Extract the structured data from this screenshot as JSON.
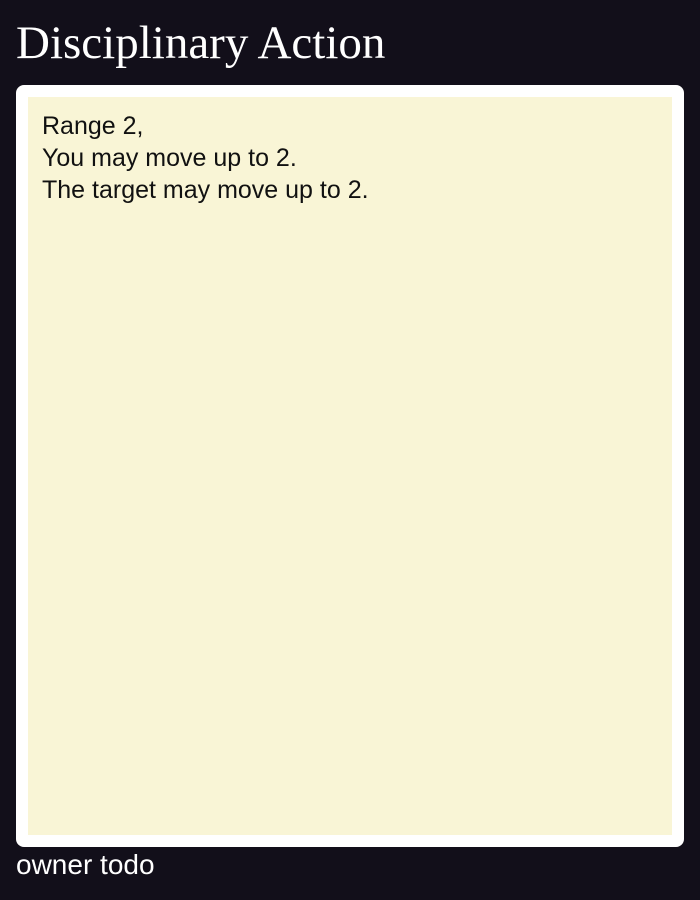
{
  "card": {
    "title": "Disciplinary Action",
    "body_lines": [
      "Range 2,",
      "You may move up to 2.",
      "The target may move up to 2."
    ],
    "footer": "owner todo"
  },
  "colors": {
    "page_background": "#120f1a",
    "card_frame": "#ffffff",
    "card_body": "#f9f5d6",
    "title_text": "#ffffff",
    "body_text": "#111111"
  }
}
